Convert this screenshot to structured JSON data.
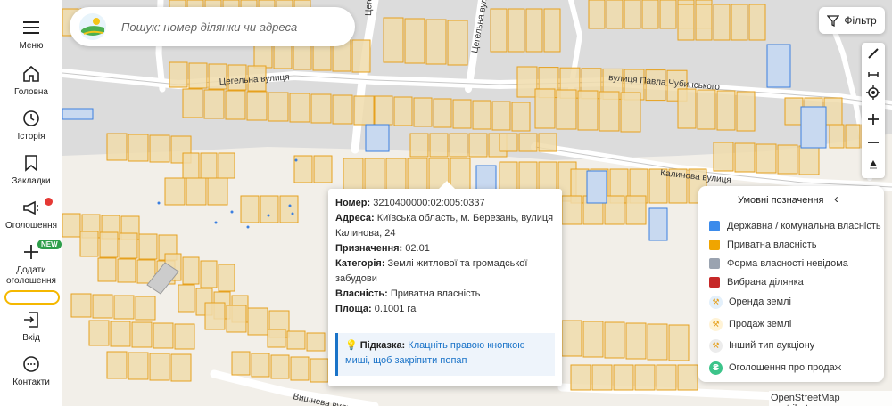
{
  "sidebar": {
    "items": [
      {
        "label": "Меню",
        "icon": "menu-icon"
      },
      {
        "label": "Головна",
        "icon": "home-icon"
      },
      {
        "label": "Історія",
        "icon": "clock-icon"
      },
      {
        "label": "Закладки",
        "icon": "bookmark-icon"
      },
      {
        "label": "Оголошення",
        "icon": "megaphone-icon"
      },
      {
        "label": "Додати оголошення",
        "icon": "plus-icon",
        "badge": "NEW"
      },
      {
        "label": "Вхід",
        "icon": "login-icon"
      },
      {
        "label": "Контакти",
        "icon": "chat-icon"
      }
    ]
  },
  "search": {
    "placeholder": "Пошук: номер ділянки чи адреса"
  },
  "filter": {
    "label": "Фільтр"
  },
  "map": {
    "streets": [
      {
        "name": "Цегельна вулиця"
      },
      {
        "name": "Цегельна вулиця"
      },
      {
        "name": "Цегельна вулиця"
      },
      {
        "name": "вулиця Павла Чубинського"
      },
      {
        "name": "Калинова вулиця"
      },
      {
        "name": "Вишнева вулиця"
      }
    ],
    "attribution": "OpenStreetMap contributors"
  },
  "popup": {
    "number_label": "Номер:",
    "number_value": "3210400000:02:005:0337",
    "address_label": "Адреса:",
    "address_value": "Київська область, м. Березань, вулиця Калинова, 24",
    "purpose_label": "Призначення:",
    "purpose_value": "02.01",
    "category_label": "Категорія:",
    "category_value": "Землі житлової та громадської забудови",
    "ownership_label": "Власність:",
    "ownership_value": "Приватна власність",
    "area_label": "Площа:",
    "area_value": "0.1001 га",
    "hint_label": "Підказка:",
    "hint_text": "Клацніть правою кнопкою миші, щоб закріпити попап"
  },
  "legend": {
    "title": "Умовні позначення",
    "items": [
      {
        "label": "Державна / комунальна власність",
        "color": "#3b8beb"
      },
      {
        "label": "Приватна власність",
        "color": "#f0a500"
      },
      {
        "label": "Форма власності невідома",
        "color": "#9aa3b0"
      },
      {
        "label": "Вибрана ділянка",
        "color": "#c62828"
      },
      {
        "label": "Оренда землі",
        "icon": "hammer-icon"
      },
      {
        "label": "Продаж землі",
        "icon": "hammer-icon"
      },
      {
        "label": "Інший тип аукціону",
        "icon": "hammer-icon"
      },
      {
        "label": "Оголошення про продаж",
        "icon": "hryvnia-icon"
      }
    ]
  },
  "colors": {
    "parcel_fill": "#f0dcab",
    "parcel_stroke": "#e6a11e",
    "state_fill": "#c8d9f0",
    "state_stroke": "#3b7fe0",
    "accent": "#1a73c8"
  }
}
